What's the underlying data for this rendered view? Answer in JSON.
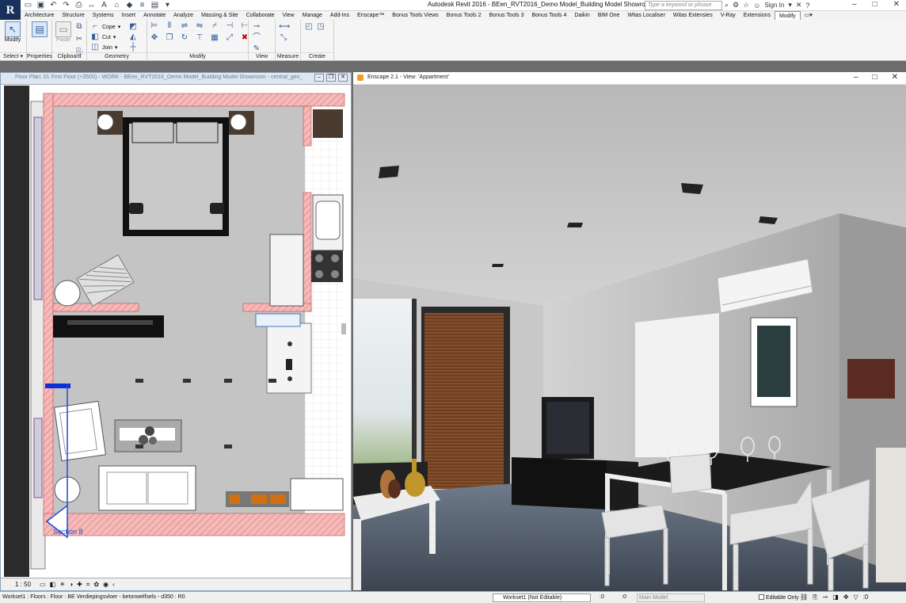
{
  "app": {
    "icon_letter": "R",
    "window_title": "Autodesk Revit 2016 -    BEen_RVT2016_Demo Model_Building Model Showroom",
    "search_placeholder": "Type a keyword or phrase",
    "sign_in": "Sign In",
    "help": "?"
  },
  "tabs": [
    "Architecture",
    "Structure",
    "Systems",
    "Insert",
    "Annotate",
    "Analyze",
    "Massing & Site",
    "Collaborate",
    "View",
    "Manage",
    "Add-Ins",
    "Enscape™",
    "Bonus Tools Views",
    "Bonus Tools 2",
    "Bonus Tools 3",
    "Bonus Tools 4",
    "Daikin",
    "BIM One",
    "Witas Localiser",
    "Witas Extensies",
    "V-Ray",
    "Extensions",
    "Modify"
  ],
  "active_tab": "Modify",
  "ribbon": {
    "panels": [
      "Select",
      "Properties",
      "Clipboard",
      "Geometry",
      "Modify",
      "View",
      "Measure",
      "Create"
    ],
    "modify_button": "Modify",
    "select_label": "Select",
    "paste_label": "Paste",
    "cope": "Cope",
    "cut": "Cut",
    "join": "Join"
  },
  "floorplan": {
    "title": "Floor Plan: 01 First Floor (+3500) - WORK - BEen_RVT2016_Demo Model_Building Model Showroom - central_gen_Norbert Le...",
    "section_label": "Section 8",
    "scale": "1 : 50"
  },
  "enscape": {
    "title": "Enscape 2.1 - View: 'Appartment'"
  },
  "status": {
    "message": "Workset1 : Floors : Floor : BE Verdiepingsvloer - betonwelfsels - d350 : R0",
    "workset": "Workset1 (Not Editable)",
    "count1": ":0",
    "count2": ":0",
    "main_model": "Main Model",
    "editable_only": "Editable Only",
    "filter_count": ":0"
  },
  "colors": {
    "wall_hatch": "#f6b9b9",
    "title_blue": "#18315a",
    "accent": "#2a5a9a"
  }
}
